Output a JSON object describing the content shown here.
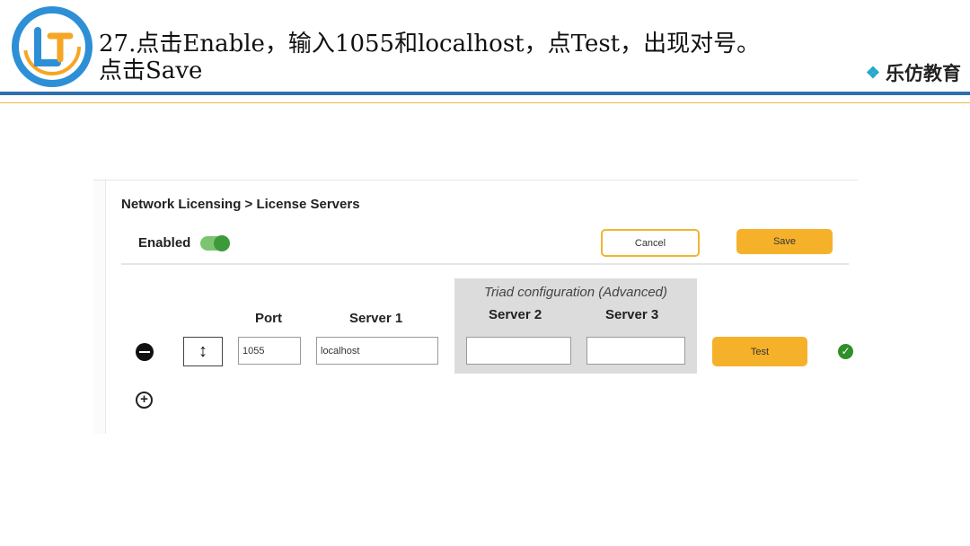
{
  "slide": {
    "title_line1": "27.点击Enable，输入1055和localhost，点Test，出现对号。",
    "title_line2": "点击Save",
    "brand_text": "乐仿教育",
    "brand_icon": "diamond-cluster-icon",
    "colors": {
      "rule_blue": "#2f6fb0",
      "rule_yellow": "#e9b94a",
      "logo_blue": "#2d8fd6",
      "logo_orange": "#f5a623"
    }
  },
  "screenshot": {
    "breadcrumb": "Network Licensing > License Servers",
    "enabled_label": "Enabled",
    "enabled_state": true,
    "cancel_label": "Cancel",
    "save_label": "Save",
    "triad_title": "Triad configuration (Advanced)",
    "columns": {
      "port": "Port",
      "server1": "Server 1",
      "server2": "Server 2",
      "server3": "Server 3"
    },
    "row": {
      "port": "1055",
      "server1": "localhost",
      "server2": "",
      "server3": ""
    },
    "test_label": "Test",
    "test_status": "check",
    "icons": {
      "remove": "minus-circle-icon",
      "drag": "vertical-arrows-icon",
      "add": "plus-circle-icon",
      "ok": "check-circle-icon"
    },
    "colors": {
      "accent": "#f6b12b",
      "toggle_on": "#3d9a3a",
      "success": "#2f8f2a"
    }
  }
}
